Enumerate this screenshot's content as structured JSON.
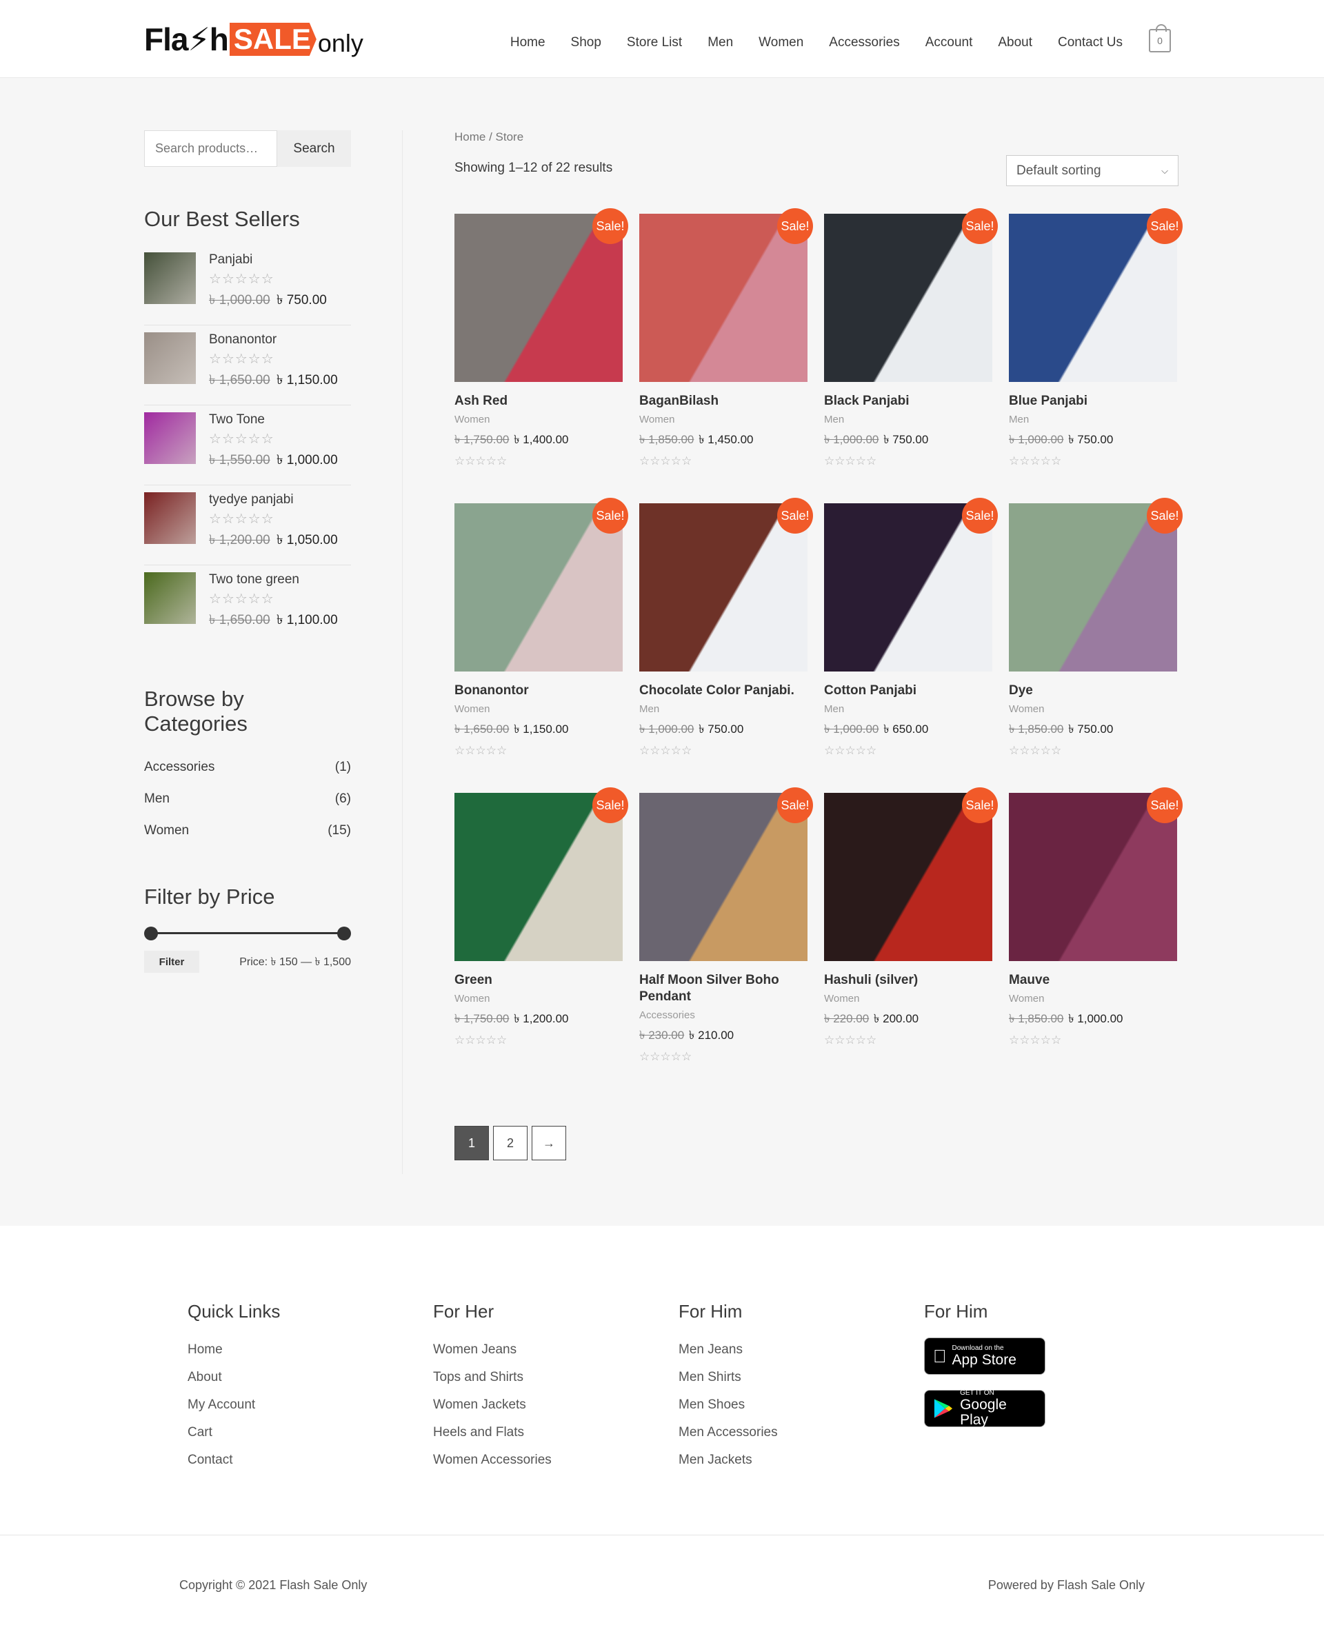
{
  "header": {
    "logo": {
      "flash": "Fla⚡h",
      "sale": "SALE",
      "only": "only"
    },
    "nav": [
      "Home",
      "Shop",
      "Store List",
      "Men",
      "Women",
      "Accessories",
      "Account",
      "About",
      "Contact Us"
    ],
    "cart_count": "0"
  },
  "sidebar": {
    "search_placeholder": "Search products…",
    "search_button": "Search",
    "best_sellers_title": "Our Best Sellers",
    "best_sellers": [
      {
        "name": "Panjabi",
        "old": "৳ 1,000.00",
        "new": "৳ 750.00",
        "color": "#45513a"
      },
      {
        "name": "Bonanontor",
        "old": "৳ 1,650.00",
        "new": "৳ 1,150.00",
        "color": "#9a8f87"
      },
      {
        "name": "Two Tone",
        "old": "৳ 1,550.00",
        "new": "৳ 1,000.00",
        "color": "#a02aa0"
      },
      {
        "name": "tyedye panjabi",
        "old": "৳ 1,200.00",
        "new": "৳ 1,050.00",
        "color": "#7a2222"
      },
      {
        "name": "Two tone green",
        "old": "৳ 1,650.00",
        "new": "৳ 1,100.00",
        "color": "#4b6a1e"
      }
    ],
    "categories_title": "Browse by Categories",
    "categories": [
      {
        "name": "Accessories",
        "count": "(1)"
      },
      {
        "name": "Men",
        "count": "(6)"
      },
      {
        "name": "Women",
        "count": "(15)"
      }
    ],
    "filter_title": "Filter by Price",
    "filter_button": "Filter",
    "price_label": "Price: ৳ 150 — ৳ 1,500",
    "price_min": 150,
    "price_max": 1500
  },
  "content": {
    "breadcrumb": "Home / Store",
    "result_count": "Showing 1–12 of 22 results",
    "sorting": "Default sorting",
    "sale_label": "Sale!",
    "products": [
      {
        "name": "Ash Red",
        "cat": "Women",
        "old": "৳ 1,750.00",
        "new": "৳ 1,400.00",
        "c1": "#7d7774",
        "c2": "#c73a4e"
      },
      {
        "name": "BaganBilash",
        "cat": "Women",
        "old": "৳ 1,850.00",
        "new": "৳ 1,450.00",
        "c1": "#cc5a55",
        "c2": "#d48896"
      },
      {
        "name": "Black Panjabi",
        "cat": "Men",
        "old": "৳ 1,000.00",
        "new": "৳ 750.00",
        "c1": "#2a2f35",
        "c2": "#e9ecef"
      },
      {
        "name": "Blue Panjabi",
        "cat": "Men",
        "old": "৳ 1,000.00",
        "new": "৳ 750.00",
        "c1": "#2a4a8a",
        "c2": "#eef0f3"
      },
      {
        "name": "Bonanontor",
        "cat": "Women",
        "old": "৳ 1,650.00",
        "new": "৳ 1,150.00",
        "c1": "#8aa48f",
        "c2": "#d9c4c4"
      },
      {
        "name": "Chocolate Color Panjabi.",
        "cat": "Men",
        "old": "৳ 1,000.00",
        "new": "৳ 750.00",
        "c1": "#6e3228",
        "c2": "#eef0f3"
      },
      {
        "name": "Cotton Panjabi",
        "cat": "Men",
        "old": "৳ 1,000.00",
        "new": "৳ 650.00",
        "c1": "#2a1c33",
        "c2": "#eef0f3"
      },
      {
        "name": "Dye",
        "cat": "Women",
        "old": "৳ 1,850.00",
        "new": "৳ 750.00",
        "c1": "#8ca58b",
        "c2": "#9a7ba0"
      },
      {
        "name": "Green",
        "cat": "Women",
        "old": "৳ 1,750.00",
        "new": "৳ 1,200.00",
        "c1": "#1f6a3c",
        "c2": "#d6d2c4"
      },
      {
        "name": "Half Moon Silver Boho Pendant",
        "cat": "Accessories",
        "old": "৳ 230.00",
        "new": "৳ 210.00",
        "c1": "#6a6570",
        "c2": "#c89a62"
      },
      {
        "name": "Hashuli (silver)",
        "cat": "Women",
        "old": "৳ 220.00",
        "new": "৳ 200.00",
        "c1": "#2a1a1a",
        "c2": "#b8271e"
      },
      {
        "name": "Mauve",
        "cat": "Women",
        "old": "৳ 1,850.00",
        "new": "৳ 1,000.00",
        "c1": "#6a2442",
        "c2": "#8e3a5e"
      }
    ],
    "pagination": [
      "1",
      "2",
      "→"
    ]
  },
  "footer": {
    "quick_links_title": "Quick Links",
    "quick_links": [
      "Home",
      "About",
      "My Account",
      "Cart",
      "Contact"
    ],
    "for_her_title": "For Her",
    "for_her": [
      "Women Jeans",
      "Tops and Shirts",
      "Women Jackets",
      "Heels and Flats",
      "Women Accessories"
    ],
    "for_him_title": "For Him",
    "for_him": [
      "Men Jeans",
      "Men Shirts",
      "Men Shoes",
      "Men Accessories",
      "Men Jackets"
    ],
    "apps_title": "For Him",
    "app_store_small": "Download on the",
    "app_store_large": "App Store",
    "google_small": "GET IT ON",
    "google_large": "Google Play",
    "copyright": "Copyright © 2021 Flash Sale Only",
    "powered": "Powered by Flash Sale Only"
  }
}
